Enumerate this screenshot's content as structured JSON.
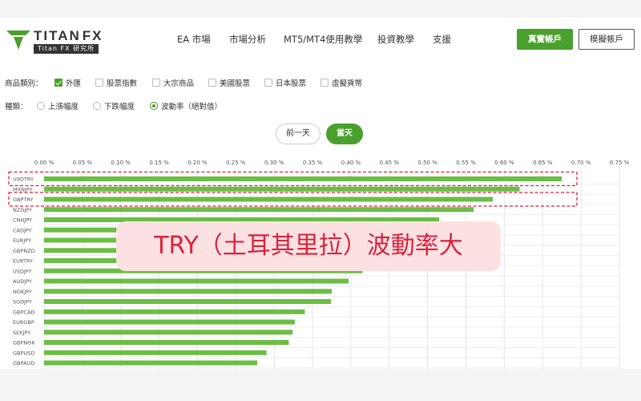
{
  "header": {
    "logo": {
      "brand_main": "TITAN",
      "brand_fx": "FX",
      "brand_sub": "Titan FX 研究所"
    },
    "nav": [
      {
        "label": "EA 市場"
      },
      {
        "label": "市場分析"
      },
      {
        "label": "MT5/MT4使用教學"
      },
      {
        "label": "投資教學"
      },
      {
        "label": "支援"
      }
    ],
    "real_account_label": "真實帳戶",
    "demo_account_label": "模擬帳戶"
  },
  "filters": {
    "category": {
      "label": "商品類別：",
      "options": [
        {
          "label": "外匯",
          "checked": true
        },
        {
          "label": "股票指數",
          "checked": false
        },
        {
          "label": "大宗商品",
          "checked": false
        },
        {
          "label": "美國股票",
          "checked": false
        },
        {
          "label": "日本股票",
          "checked": false
        },
        {
          "label": "虛擬貨幣",
          "checked": false
        }
      ]
    },
    "type": {
      "label": "種類：",
      "options": [
        {
          "label": "上漲幅度",
          "selected": false
        },
        {
          "label": "下跌幅度",
          "selected": false
        },
        {
          "label": "波動率（絕對值）",
          "selected": true
        }
      ]
    }
  },
  "day_buttons": {
    "previous": "前一天",
    "today": "當天"
  },
  "chart_data": {
    "type": "bar",
    "orientation": "horizontal",
    "x_ticks": [
      "0.00 %",
      "0.05 %",
      "0.10 %",
      "0.15 %",
      "0.20 %",
      "0.25 %",
      "0.30 %",
      "0.35 %",
      "0.40 %",
      "0.45 %",
      "0.50 %",
      "0.55 %",
      "0.60 %",
      "0.65 %",
      "0.70 %",
      "0.75 %"
    ],
    "xlim": [
      0,
      0.75
    ],
    "unit": "%",
    "categories": [
      "USDTRY",
      "MXNJPY",
      "GBPTRY",
      "NZDJPY",
      "CNHJPY",
      "CADJPY",
      "EURJPY",
      "GBPNZD",
      "EURTRY",
      "USDJPY",
      "AUDJPY",
      "NOKJPY",
      "SGDJPY",
      "GBPCAD",
      "EURGBP",
      "SEKJPY",
      "GBPNOK",
      "GBPUSD",
      "GBPAUD"
    ],
    "values": [
      0.675,
      0.62,
      0.585,
      0.56,
      0.515,
      0.495,
      0.49,
      0.475,
      0.45,
      0.415,
      0.397,
      0.375,
      0.374,
      0.34,
      0.327,
      0.324,
      0.319,
      0.29,
      0.278
    ],
    "bar_color": "#6cbd45",
    "grid": true,
    "highlighted": [
      "USDTRY",
      "GBPTRY"
    ],
    "highlight_color": "#d8233c"
  },
  "annotation": {
    "text": "TRY（土耳其里拉）波動率大"
  },
  "colors": {
    "accent": "#4aa02c",
    "annotation_bg": "#fce1e3"
  }
}
